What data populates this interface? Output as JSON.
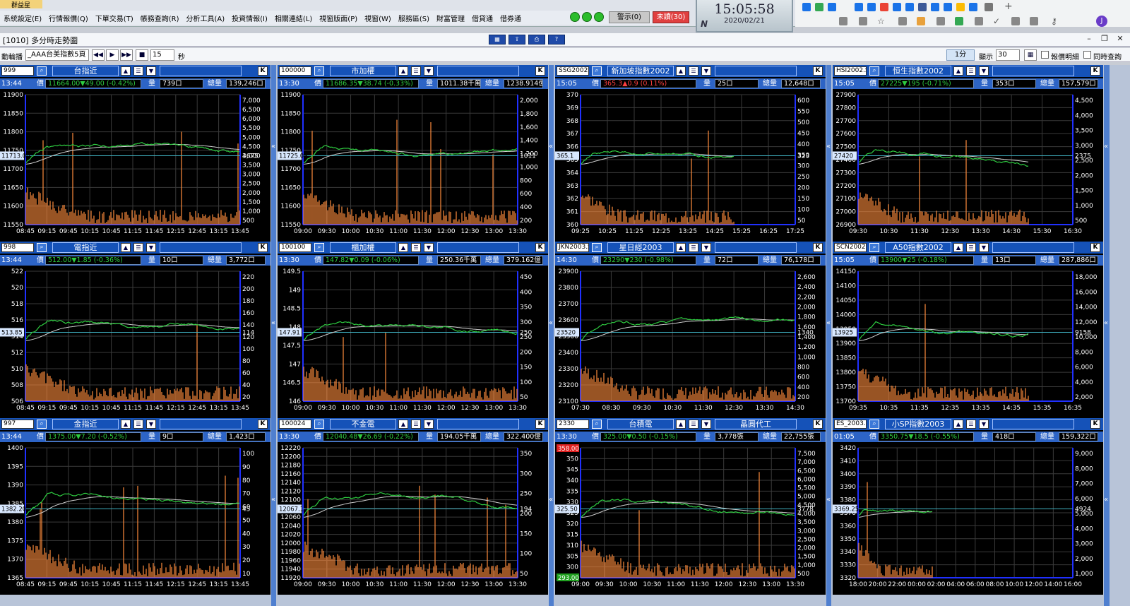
{
  "app": {
    "title": "群益星"
  },
  "menu": [
    "系統設定(E)",
    "行情報價(Q)",
    "下單交易(T)",
    "帳務查詢(R)",
    "分析工具(A)",
    "投資情報(I)",
    "相關連結(L)",
    "視窗版面(P)",
    "視窗(W)",
    "服務區(S)",
    "財富管理",
    "借貸通",
    "借券通"
  ],
  "alerts": {
    "warn": "警示(0)",
    "unread": "未讀(30)"
  },
  "clock": {
    "time": "15:05:58",
    "date": "2020/02/21",
    "badge": "N"
  },
  "window": {
    "title": "[1010] 多分時走勢圖"
  },
  "controls": {
    "rotate_label": "動輪播",
    "group_value": "_AAA台美指數5頁",
    "interval_value": "15",
    "interval_unit": "秒",
    "period": "1分",
    "display_label": "顯示",
    "display_value": "30",
    "detail_label": "報價明細",
    "sync_label": "同時查詢"
  },
  "panels": [
    {
      "code": "999",
      "name": "台指近",
      "extra": "",
      "time": "13:44",
      "price_label": "價",
      "price": "11664.00▼49.00 (-0.42%)",
      "vol_label": "量",
      "vol": "739口",
      "tot_label": "總量",
      "tot": "139,246口",
      "ref": "11713.00",
      "vref": "3675",
      "y": [
        "11900",
        "11850",
        "11800",
        "11750",
        "11700",
        "11650",
        "11600",
        "11550"
      ],
      "v": [
        "7,000",
        "6,500",
        "6,000",
        "5,500",
        "5,000",
        "4,500",
        "4,000",
        "3,500",
        "3,000",
        "2,500",
        "2,000",
        "1,500",
        "1,000",
        "500"
      ],
      "x": [
        "08:45",
        "09:15",
        "09:45",
        "10:15",
        "10:45",
        "11:15",
        "11:45",
        "12:15",
        "12:45",
        "13:15",
        "13:45"
      ],
      "seed": 1,
      "end": 1.0
    },
    {
      "code": "100000",
      "name": "市加權",
      "extra": "",
      "time": "13:30",
      "price_label": "價",
      "price": "11686.35▼38.74 (-0.33%)",
      "vol_label": "量",
      "vol": "1011.38千萬",
      "tot_label": "總量",
      "tot": "1238.914億",
      "ref": "11725.09",
      "vref": "1011",
      "y": [
        "11900",
        "11850",
        "11800",
        "11750",
        "11700",
        "11650",
        "11600",
        "11550"
      ],
      "v": [
        "2,000",
        "1,800",
        "1,600",
        "1,400",
        "1,200",
        "1,000",
        "800",
        "600",
        "400",
        "200"
      ],
      "x": [
        "09:00",
        "09:30",
        "10:00",
        "10:30",
        "11:00",
        "11:30",
        "12:00",
        "12:30",
        "13:00",
        "13:30"
      ],
      "seed": 2,
      "end": 1.0
    },
    {
      "code": "SSG2002.S",
      "name": "新加坡指數2002",
      "extra": "",
      "time": "15:05",
      "price_label": "價",
      "price": "365.3▲0.9 (0.11%)",
      "vol_label": "量",
      "vol": "25口",
      "tot_label": "總量",
      "tot": "12,648口",
      "ref": "365.1",
      "vref": "323",
      "y": [
        "370",
        "369",
        "368",
        "367",
        "366",
        "365",
        "364",
        "363",
        "362",
        "361",
        "360"
      ],
      "v": [
        "600",
        "550",
        "500",
        "450",
        "400",
        "350",
        "300",
        "250",
        "200",
        "150",
        "100",
        "50"
      ],
      "x": [
        "09:25",
        "10:25",
        "11:25",
        "12:25",
        "13:25",
        "14:25",
        "15:25",
        "16:25",
        "17:25"
      ],
      "seed": 3,
      "end": 0.72
    },
    {
      "code": "HSI2002.S",
      "name": "恒生指數2002",
      "extra": "",
      "time": "15:05",
      "price_label": "價",
      "price": "27225▼195 (-0.71%)",
      "vol_label": "量",
      "vol": "353口",
      "tot_label": "總量",
      "tot": "157,579口",
      "ref": "27420",
      "vref": "2375",
      "y": [
        "27900",
        "27800",
        "27700",
        "27600",
        "27500",
        "27400",
        "27300",
        "27200",
        "27100",
        "27000",
        "26900"
      ],
      "v": [
        "4,500",
        "4,000",
        "3,500",
        "3,000",
        "2,500",
        "2,000",
        "1,500",
        "1,000",
        "500"
      ],
      "x": [
        "09:30",
        "10:30",
        "11:30",
        "12:30",
        "13:30",
        "14:30",
        "15:30",
        "16:30"
      ],
      "seed": 4,
      "end": 0.8
    },
    {
      "code": "998",
      "name": "電指近",
      "extra": "",
      "time": "13:44",
      "price_label": "價",
      "price": "512.00▼1.85 (-0.36%)",
      "vol_label": "量",
      "vol": "10口",
      "tot_label": "總量",
      "tot": "3,772口",
      "ref": "513.85",
      "vref": "114",
      "y": [
        "522",
        "520",
        "518",
        "516",
        "514",
        "512",
        "510",
        "508",
        "506"
      ],
      "v": [
        "220",
        "200",
        "180",
        "160",
        "140",
        "120",
        "100",
        "80",
        "60",
        "40",
        "20"
      ],
      "x": [
        "08:45",
        "09:15",
        "09:45",
        "10:15",
        "10:45",
        "11:15",
        "11:45",
        "12:15",
        "12:45",
        "13:15",
        "13:45"
      ],
      "seed": 5,
      "end": 1.0
    },
    {
      "code": "100100",
      "name": "櫃加權",
      "extra": "",
      "time": "13:30",
      "price_label": "價",
      "price": "147.82▼0.09 (-0.06%)",
      "vol_label": "量",
      "vol": "250.36千萬",
      "tot_label": "總量",
      "tot": "379.162億",
      "ref": "147.91",
      "vref": "250",
      "y": [
        "149.5",
        "149",
        "148.5",
        "148",
        "147.5",
        "147",
        "146.5",
        "146"
      ],
      "v": [
        "450",
        "400",
        "350",
        "300",
        "250",
        "200",
        "150",
        "100",
        "50"
      ],
      "x": [
        "09:00",
        "09:30",
        "10:00",
        "10:30",
        "11:00",
        "11:30",
        "12:00",
        "12:30",
        "13:00",
        "13:30"
      ],
      "seed": 6,
      "end": 1.0
    },
    {
      "code": "JKN2003.S",
      "name": "星日經2003",
      "extra": "",
      "time": "14:30",
      "price_label": "價",
      "price": "23290▼230 (-0.98%)",
      "vol_label": "量",
      "vol": "72口",
      "tot_label": "總量",
      "tot": "76,178口",
      "ref": "23520",
      "vref": "1340",
      "y": [
        "23900",
        "23800",
        "23700",
        "23600",
        "23500",
        "23400",
        "23300",
        "23200",
        "23100"
      ],
      "v": [
        "2,600",
        "2,400",
        "2,200",
        "2,000",
        "1,800",
        "1,600",
        "1,400",
        "1,200",
        "1,000",
        "800",
        "600",
        "400",
        "200"
      ],
      "x": [
        "07:30",
        "08:30",
        "09:30",
        "10:30",
        "11:30",
        "12:30",
        "13:30",
        "14:30"
      ],
      "seed": 7,
      "end": 1.0
    },
    {
      "code": "SCN2002.S",
      "name": "A50指數2002",
      "extra": "",
      "time": "15:05",
      "price_label": "價",
      "price": "13900▼25 (-0.18%)",
      "vol_label": "量",
      "vol": "13口",
      "tot_label": "總量",
      "tot": "287,886口",
      "ref": "13925",
      "vref": "9158",
      "y": [
        "14150",
        "14100",
        "14050",
        "14000",
        "13950",
        "13900",
        "13850",
        "13800",
        "13750",
        "13700"
      ],
      "v": [
        "18,000",
        "16,000",
        "14,000",
        "12,000",
        "10,000",
        "8,000",
        "6,000",
        "4,000",
        "2,000"
      ],
      "x": [
        "09:35",
        "10:35",
        "11:35",
        "12:35",
        "13:35",
        "14:35",
        "15:35",
        "16:35"
      ],
      "seed": 8,
      "end": 0.8
    },
    {
      "code": "997",
      "name": "金指近",
      "extra": "",
      "time": "13:44",
      "price_label": "價",
      "price": "1375.00▼7.20 (-0.52%)",
      "vol_label": "量",
      "vol": "9口",
      "tot_label": "總量",
      "tot": "1,423口",
      "ref": "1382.20",
      "vref": "45",
      "y": [
        "1400",
        "1395",
        "1390",
        "1385",
        "1380",
        "1375",
        "1370",
        "1365"
      ],
      "v": [
        "100",
        "90",
        "80",
        "70",
        "60",
        "50",
        "40",
        "30",
        "20",
        "10"
      ],
      "x": [
        "08:45",
        "09:15",
        "09:45",
        "10:15",
        "10:45",
        "11:15",
        "11:45",
        "12:15",
        "12:45",
        "13:15",
        "13:45"
      ],
      "seed": 9,
      "end": 1.0
    },
    {
      "code": "100024",
      "name": "不金電",
      "extra": "",
      "time": "13:30",
      "price_label": "價",
      "price": "12040.48▼26.69 (-0.22%)",
      "vol_label": "量",
      "vol": "194.05千萬",
      "tot_label": "總量",
      "tot": "322.400億",
      "ref": "12067.17",
      "vref": "194",
      "y": [
        "12220",
        "12200",
        "12180",
        "12160",
        "12140",
        "12120",
        "12100",
        "12080",
        "12060",
        "12040",
        "12020",
        "12000",
        "11980",
        "11960",
        "11940",
        "11920"
      ],
      "v": [
        "350",
        "300",
        "250",
        "200",
        "150",
        "100",
        "50"
      ],
      "x": [
        "09:00",
        "09:30",
        "10:00",
        "10:30",
        "11:00",
        "11:30",
        "12:00",
        "12:30",
        "13:00",
        "13:30"
      ],
      "seed": 10,
      "end": 1.0
    },
    {
      "code": "2330",
      "name": "台積電",
      "extra": "晶圓代工",
      "time": "13:30",
      "price_label": "價",
      "price": "325.00▼0.50 (-0.15%)",
      "vol_label": "量",
      "vol": "3,778張",
      "tot_label": "總量",
      "tot": "22,755張",
      "ref": "325.50",
      "vref": "3778",
      "hi": "358.00",
      "lo": "293.00",
      "y": [
        "355",
        "350",
        "345",
        "340",
        "335",
        "330",
        "325",
        "320",
        "315",
        "310",
        "305",
        "300",
        "295"
      ],
      "v": [
        "7,500",
        "7,000",
        "6,500",
        "6,000",
        "5,500",
        "5,000",
        "4,500",
        "4,000",
        "3,500",
        "3,000",
        "2,500",
        "2,000",
        "1,500",
        "1,000",
        "500"
      ],
      "x": [
        "09:00",
        "09:30",
        "10:00",
        "10:30",
        "11:00",
        "11:30",
        "12:00",
        "12:30",
        "13:00",
        "13:30"
      ],
      "seed": 11,
      "end": 1.0
    },
    {
      "code": "ES_2003.S",
      "name": "小SP指數2003",
      "extra": "",
      "time": "01:05",
      "price_label": "價",
      "price": "3350.75▼18.5 (-0.55%)",
      "vol_label": "量",
      "vol": "418口",
      "tot_label": "總量",
      "tot": "159,322口",
      "ref": "3369.25",
      "vref": "4924",
      "y": [
        "3420",
        "3410",
        "3400",
        "3390",
        "3380",
        "3370",
        "3360",
        "3350",
        "3340",
        "3330",
        "3320"
      ],
      "v": [
        "9,000",
        "8,000",
        "7,000",
        "6,000",
        "5,000",
        "4,000",
        "3,000",
        "2,000",
        "1,000"
      ],
      "x": [
        "18:00",
        "20:00",
        "22:00",
        "00:00",
        "02:00",
        "04:00",
        "06:00",
        "08:00",
        "10:00",
        "12:00",
        "14:00",
        "16:00"
      ],
      "seed": 12,
      "end": 0.35
    }
  ],
  "colors": {
    "panel_bg": "#000000",
    "header_blue": "#1552b8",
    "price_line": "#2ecc40",
    "volume": "#ff8c3c",
    "avg_line": "#d0d0d0",
    "ref_line": "#3fb0c0",
    "axis": "#2030ff"
  }
}
